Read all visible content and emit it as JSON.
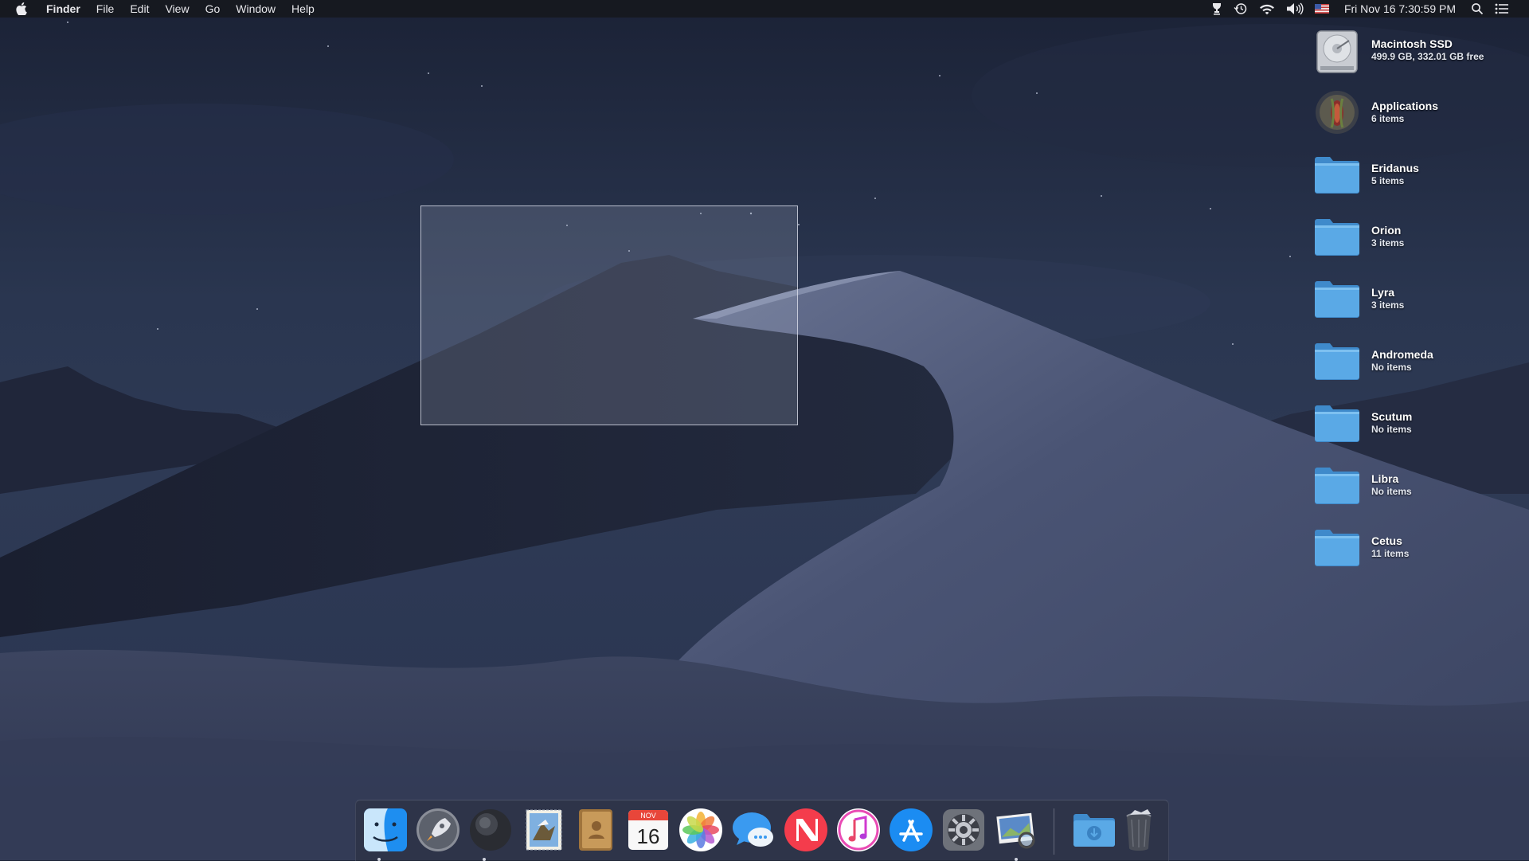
{
  "menubar": {
    "app_name": "Finder",
    "menus": [
      "File",
      "Edit",
      "View",
      "Go",
      "Window",
      "Help"
    ],
    "clock": "Fri Nov 16  7:30:59 PM",
    "status_icons": [
      "trophy-icon",
      "time-machine-icon",
      "wifi-icon",
      "volume-icon",
      "us-flag-icon"
    ]
  },
  "desktop_items": [
    {
      "name": "Macintosh SSD",
      "info": "499.9 GB, 332.01 GB free",
      "kind": "drive"
    },
    {
      "name": "Applications",
      "info": "6 items",
      "kind": "applications"
    },
    {
      "name": "Eridanus",
      "info": "5 items",
      "kind": "folder"
    },
    {
      "name": "Orion",
      "info": "3 items",
      "kind": "folder"
    },
    {
      "name": "Lyra",
      "info": "3 items",
      "kind": "folder"
    },
    {
      "name": "Andromeda",
      "info": "No items",
      "kind": "folder"
    },
    {
      "name": "Scutum",
      "info": "No items",
      "kind": "folder"
    },
    {
      "name": "Libra",
      "info": "No items",
      "kind": "folder"
    },
    {
      "name": "Cetus",
      "info": "11 items",
      "kind": "folder"
    }
  ],
  "dock": {
    "apps": [
      "Finder",
      "Launchpad",
      "Dark Sky",
      "Mail",
      "Contacts",
      "Calendar",
      "Photos",
      "Messages",
      "News",
      "iTunes",
      "App Store",
      "System Preferences",
      "Preview"
    ],
    "calendar": {
      "month": "NOV",
      "day": "16"
    },
    "stacks": [
      "Downloads",
      "Trash"
    ],
    "running": [
      "Finder",
      "Dark Sky",
      "Preview"
    ]
  },
  "colors": {
    "folder": "#4a9ad8",
    "menubar": "#16181e",
    "accent": "#1b8cf2"
  }
}
